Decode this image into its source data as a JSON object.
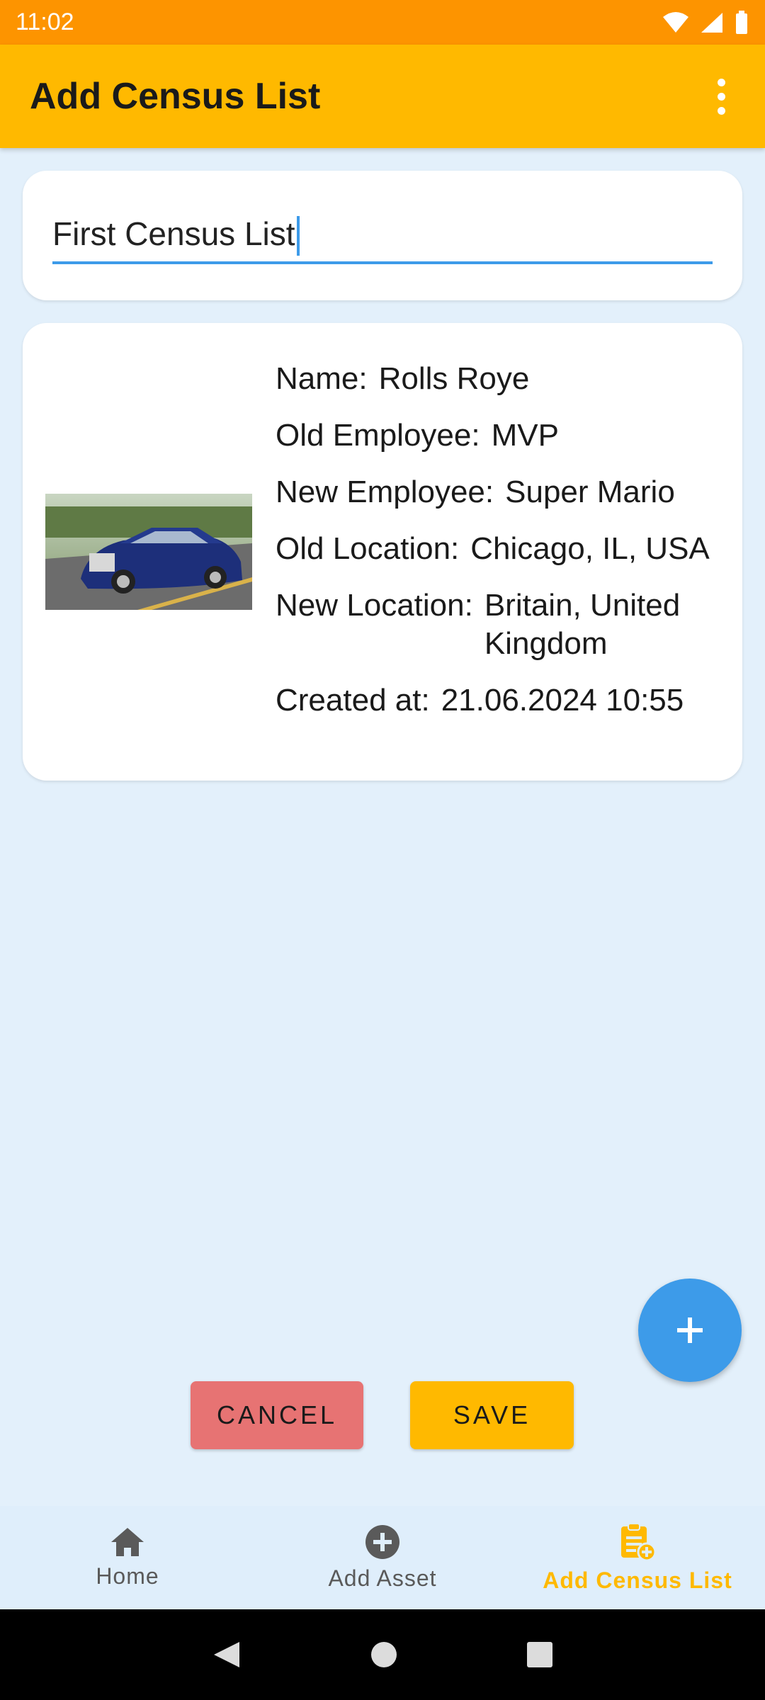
{
  "status_bar": {
    "time": "11:02"
  },
  "app_bar": {
    "title": "Add Census List"
  },
  "census_name": {
    "value": "First Census List"
  },
  "asset": {
    "image_alt": "Rolls Royce car",
    "fields": [
      {
        "label": "Name:",
        "value": "Rolls Roye"
      },
      {
        "label": "Old Employee:",
        "value": "MVP"
      },
      {
        "label": "New Employee:",
        "value": "Super Mario"
      },
      {
        "label": "Old Location:",
        "value": "Chicago, IL, USA"
      },
      {
        "label": "New Location:",
        "value": "Britain, United Kingdom"
      },
      {
        "label": "Created at:",
        "value": "21.06.2024 10:55"
      }
    ]
  },
  "actions": {
    "cancel_label": "CANCEL",
    "save_label": "SAVE",
    "fab_icon": "plus-icon"
  },
  "bottom_nav": {
    "items": [
      {
        "label": "Home",
        "icon": "home-icon",
        "active": false
      },
      {
        "label": "Add Asset",
        "icon": "add-circle-icon",
        "active": false
      },
      {
        "label": "Add Census List",
        "icon": "clipboard-add-icon",
        "active": true
      }
    ]
  },
  "colors": {
    "primary": "#ffb900",
    "status_bar": "#fd9400",
    "accent": "#3d9be9",
    "cancel": "#e77373",
    "background": "#e3f0fb"
  }
}
